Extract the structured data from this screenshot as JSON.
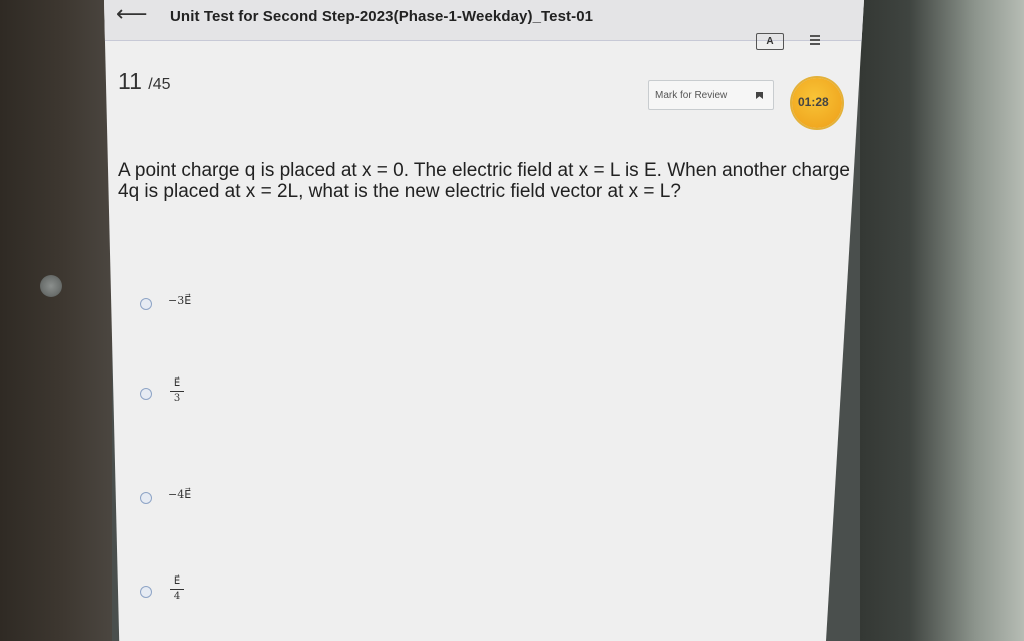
{
  "header": {
    "back_icon": "arrow-left-icon",
    "title": "Unit Test for Second Step-2023(Phase-1-Weekday)_Test-01",
    "language_icon_label": "A",
    "menu_icon": "menu-icon"
  },
  "question_counter": {
    "current": "11",
    "total": "/45"
  },
  "review": {
    "label": "Mark for Review",
    "icon": "bookmark-icon"
  },
  "timer": {
    "time": "01:28"
  },
  "question": {
    "text": "A point charge q is placed at x = 0. The electric field at x = L is E. When another charge 4q is placed at x = 2L, what is the new electric field vector at x = L?"
  },
  "options": [
    {
      "label": "−3E⃗"
    },
    {
      "numerator": "E⃗",
      "denominator": "3"
    },
    {
      "label": "−4E⃗"
    },
    {
      "numerator": "E⃗",
      "denominator": "4"
    }
  ],
  "colors": {
    "timer": "#f0a51e",
    "screen": "#efefef",
    "radio": "#8ea4c6"
  }
}
